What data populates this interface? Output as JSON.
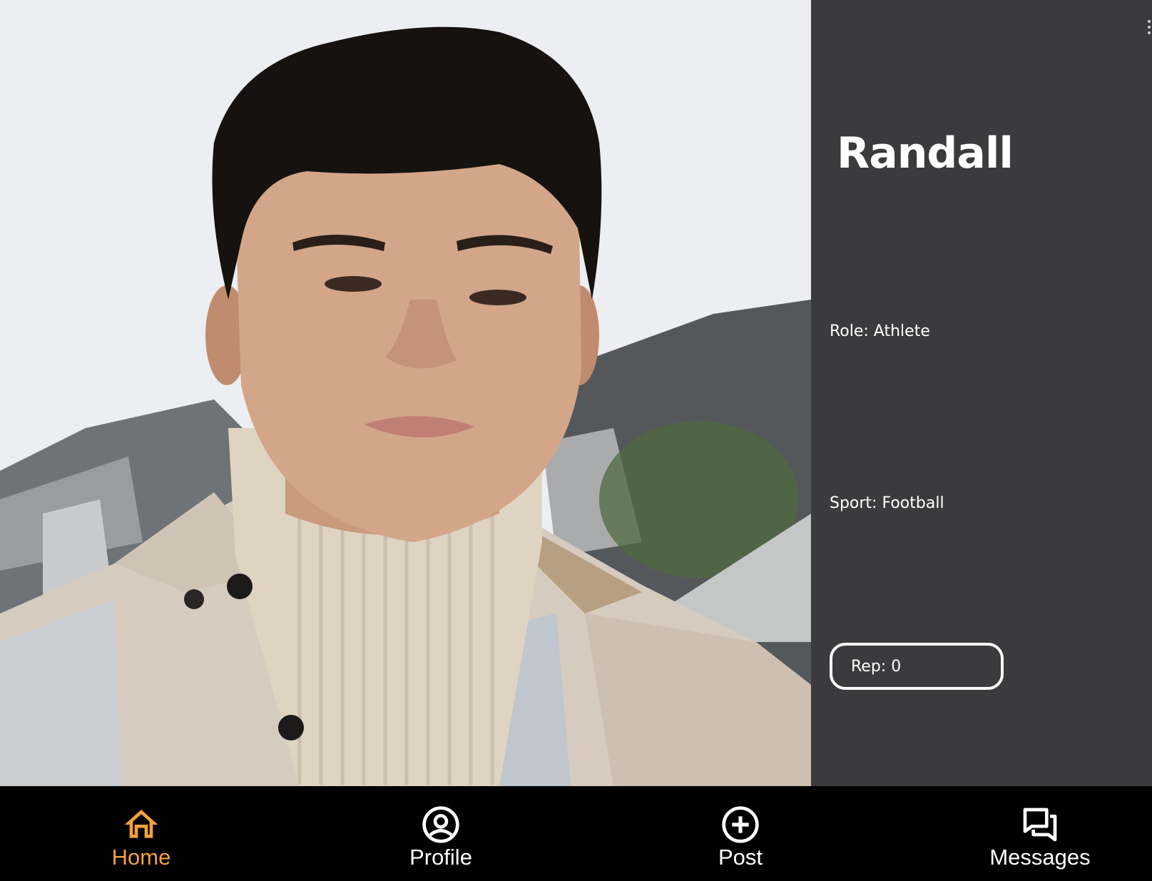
{
  "profile": {
    "name": "Randall",
    "role": "Role: Athlete",
    "sport": "Sport: Football",
    "rep": "Rep: 0"
  },
  "nav": {
    "items": [
      {
        "label": "Home",
        "icon": "home-icon",
        "active": true
      },
      {
        "label": "Profile",
        "icon": "account-circle-icon",
        "active": false
      },
      {
        "label": "Post",
        "icon": "add-circle-icon",
        "active": false
      },
      {
        "label": "Messages",
        "icon": "forum-icon",
        "active": false
      }
    ]
  },
  "colors": {
    "panel_bg": "#3b3b3d",
    "nav_bg": "#000000",
    "accent": "#f4a23a",
    "text": "#ffffff"
  }
}
